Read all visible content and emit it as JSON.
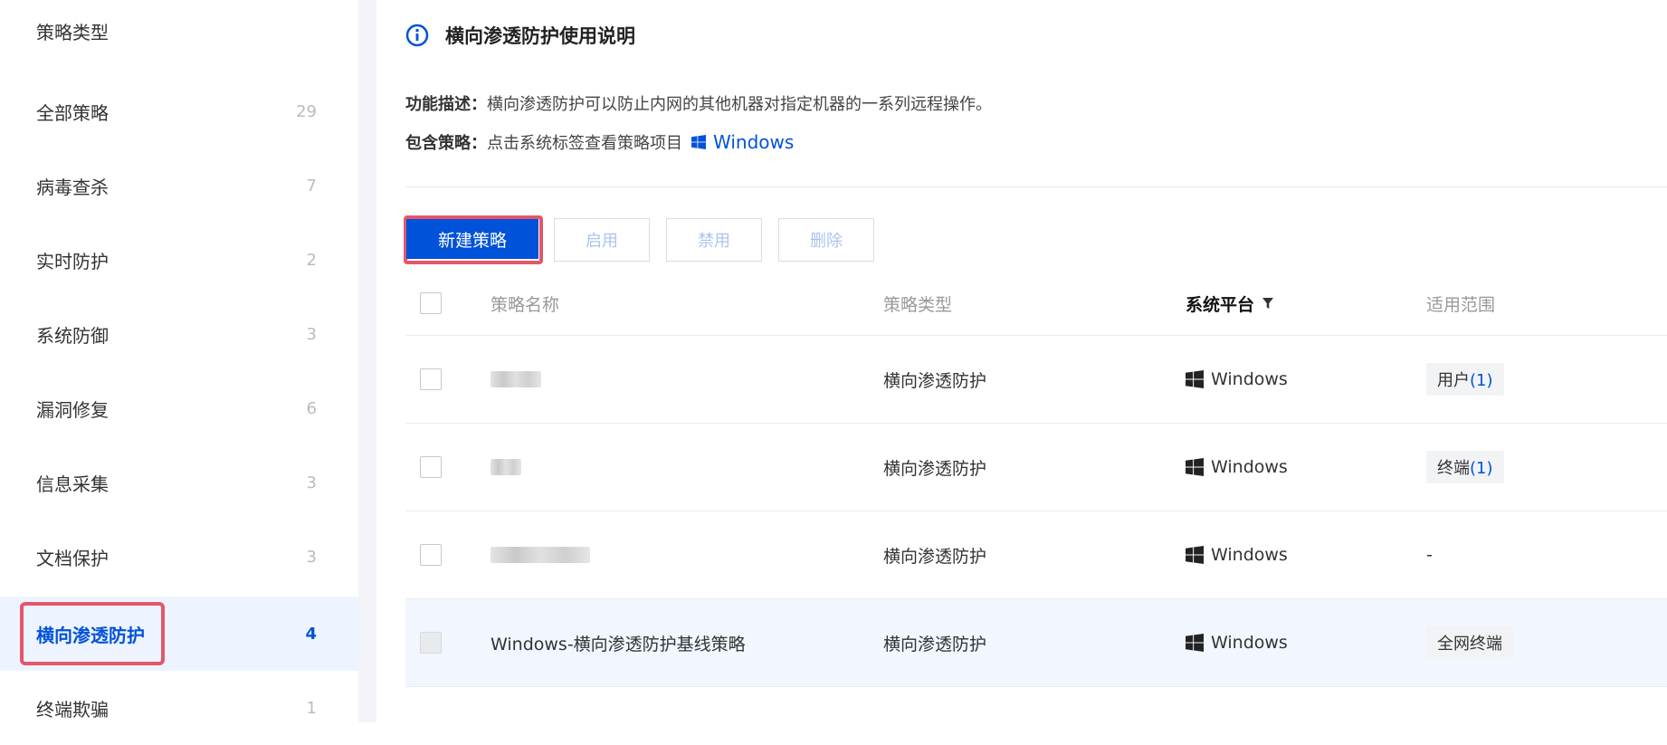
{
  "sidebar": {
    "header": "策略类型",
    "items": [
      {
        "label": "全部策略",
        "count": "29"
      },
      {
        "label": "病毒查杀",
        "count": "7"
      },
      {
        "label": "实时防护",
        "count": "2"
      },
      {
        "label": "系统防御",
        "count": "3"
      },
      {
        "label": "漏洞修复",
        "count": "6"
      },
      {
        "label": "信息采集",
        "count": "3"
      },
      {
        "label": "文档保护",
        "count": "3"
      },
      {
        "label": "横向渗透防护",
        "count": "4"
      },
      {
        "label": "终端欺骗",
        "count": "1"
      }
    ]
  },
  "info": {
    "title": "横向渗透防护使用说明",
    "desc_label": "功能描述：",
    "desc_text": "横向渗透防护可以防止内网的其他机器对指定机器的一系列远程操作。",
    "policy_label": "包含策略：",
    "policy_text": "点击系统标签查看策略项目",
    "platform_link": "Windows"
  },
  "toolbar": {
    "new": "新建策略",
    "enable": "启用",
    "disable": "禁用",
    "delete": "删除"
  },
  "table": {
    "headers": {
      "name": "策略名称",
      "type": "策略类型",
      "platform": "系统平台",
      "scope": "适用范围"
    },
    "rows": [
      {
        "name": "",
        "type": "横向渗透防护",
        "platform": "Windows",
        "scope_prefix": "用户",
        "scope_num": "(1)"
      },
      {
        "name": "",
        "type": "横向渗透防护",
        "platform": "Windows",
        "scope_prefix": "终端",
        "scope_num": "(1)"
      },
      {
        "name": "",
        "type": "横向渗透防护",
        "platform": "Windows",
        "scope_text": "-"
      },
      {
        "name": "Windows-横向渗透防护基线策略",
        "type": "横向渗透防护",
        "platform": "Windows",
        "scope_tag": "全网终端"
      }
    ]
  },
  "colors": {
    "accent": "#0052d9",
    "highlight": "#e5566a"
  }
}
